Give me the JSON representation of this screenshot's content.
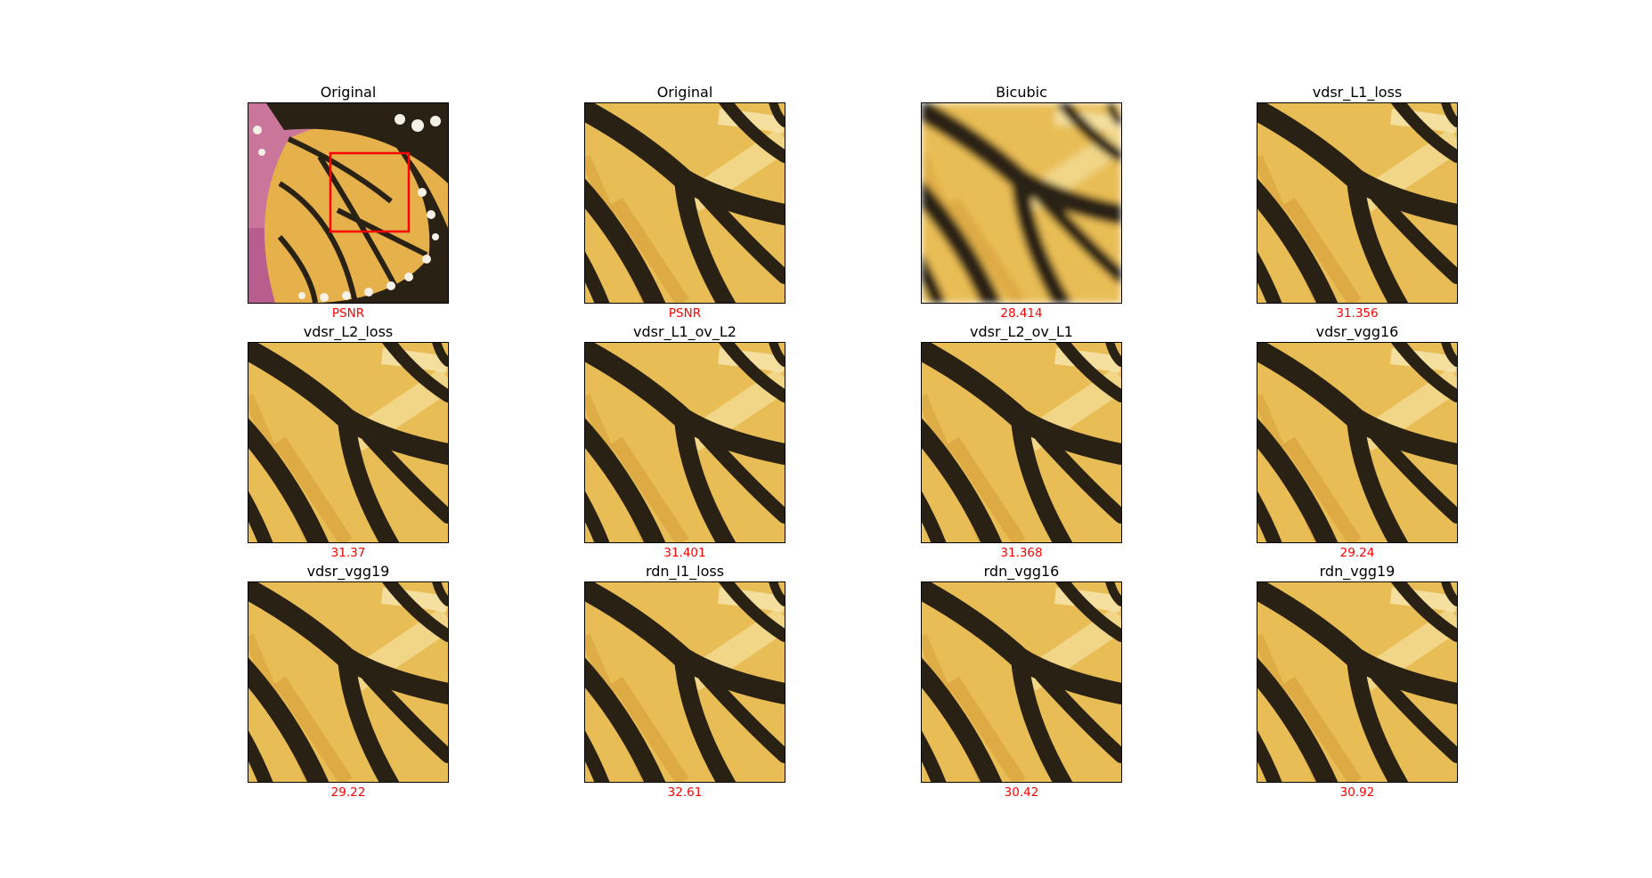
{
  "colors": {
    "caption": "#ff0000",
    "highlight_box": "#ff0000",
    "wing": "#e9bd55",
    "vein": "#2a2115"
  },
  "panels": [
    {
      "title": "Original",
      "caption": "PSNR",
      "image": "full-butterfly"
    },
    {
      "title": "Original",
      "caption": "PSNR",
      "image": "crop"
    },
    {
      "title": "Bicubic",
      "caption": "28.414",
      "image": "crop-blurred"
    },
    {
      "title": "vdsr_L1_loss",
      "caption": "31.356",
      "image": "crop"
    },
    {
      "title": "vdsr_L2_loss",
      "caption": "31.37",
      "image": "crop"
    },
    {
      "title": "vdsr_L1_ov_L2",
      "caption": "31.401",
      "image": "crop"
    },
    {
      "title": "vdsr_L2_ov_L1",
      "caption": "31.368",
      "image": "crop"
    },
    {
      "title": "vdsr_vgg16",
      "caption": "29.24",
      "image": "crop"
    },
    {
      "title": "vdsr_vgg19",
      "caption": "29.22",
      "image": "crop"
    },
    {
      "title": "rdn_l1_loss",
      "caption": "32.61",
      "image": "crop"
    },
    {
      "title": "rdn_vgg16",
      "caption": "30.42",
      "image": "crop"
    },
    {
      "title": "rdn_vgg19",
      "caption": "30.92",
      "image": "crop"
    }
  ]
}
